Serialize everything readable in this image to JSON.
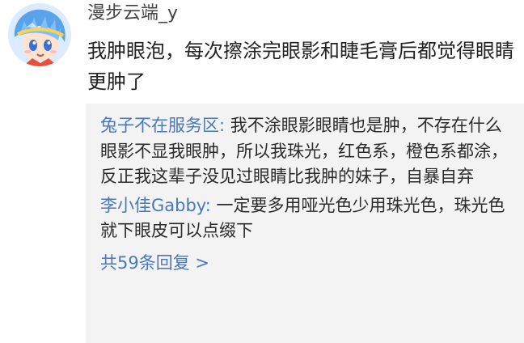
{
  "post": {
    "username": "漫步云端_y",
    "content": "我肿眼泡，每次擦涂完眼影和睫毛膏后都觉得眼睛更肿了",
    "avatar_icon": "anime-avatar-icon"
  },
  "replies": {
    "items": [
      {
        "author": "兔子不在服务区",
        "separator": ": ",
        "text": "我不涂眼影眼睛也是肿，不存在什么眼影不显我眼肿，所以我珠光，红色系，橙色系都涂，反正我这辈子没见过眼睛比我肿的妹子，自暴自弃"
      },
      {
        "author": "李小佳Gabby",
        "separator": ": ",
        "text": "一定要多用哑光色少用珠光色，珠光色就下眼皮可以点缀下"
      }
    ],
    "more_label": "共59条回复 >"
  },
  "colors": {
    "link": "#4a78b8",
    "reply_background": "#f3f3f3",
    "text": "#222222"
  }
}
